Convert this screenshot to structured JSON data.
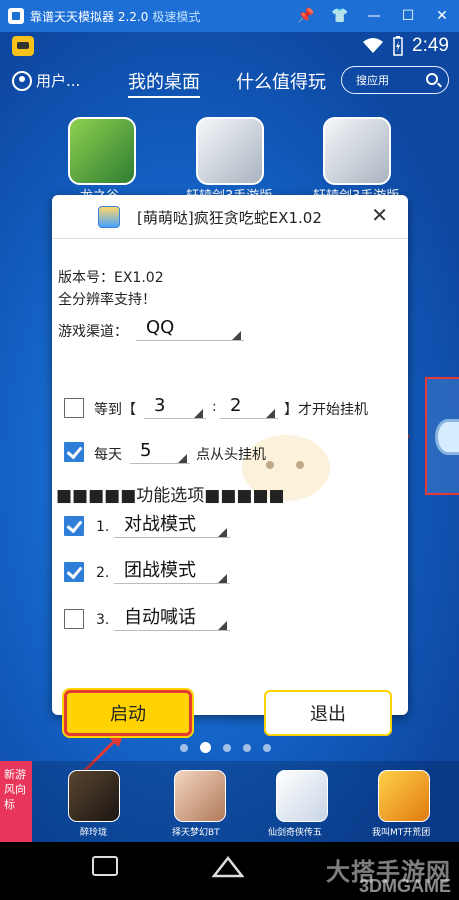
{
  "emulator": {
    "title": "靠谱天天模拟器 2.2.0",
    "mode": "极速模式",
    "controls": [
      "pin-icon",
      "skin-icon",
      "minimize-icon",
      "maximize-icon",
      "close-icon"
    ]
  },
  "status_bar": {
    "time": "2:49"
  },
  "top_nav": {
    "user_label": "用户...",
    "tabs": [
      "我的桌面",
      "什么值得玩"
    ],
    "search_placeholder": "搜应用"
  },
  "desktop_apps": [
    {
      "label": "龙之谷",
      "color": "#6bbf3a"
    },
    {
      "label": "轩辕剑3手游版",
      "color": "#e9eef4"
    },
    {
      "label": "轩辕剑3手游版",
      "color": "#e9eef4"
    }
  ],
  "dialog": {
    "title": "[萌萌哒]疯狂贪吃蛇EX1.02",
    "version_line": "版本号：EX1.02",
    "support_line": "全分辨率支持！",
    "channel_label": "游戏渠道：",
    "channel_value": "QQ",
    "wait_label": "等到【",
    "wait_hour": "3",
    "wait_sep": ":",
    "wait_min": "2",
    "wait_suffix": "】才开始挂机",
    "daily_label": "每天",
    "daily_hour": "5",
    "daily_suffix": "点从头挂机",
    "section_header": "■■■■■功能选项■■■■■",
    "options": [
      {
        "num": "1.",
        "value": "对战模式",
        "checked": true
      },
      {
        "num": "2.",
        "value": "团战模式",
        "checked": true
      },
      {
        "num": "3.",
        "value": "自动喊话",
        "checked": false
      }
    ],
    "start_label": "启动",
    "exit_label": "退出"
  },
  "pager": {
    "pages": 5,
    "active": 1
  },
  "new_tag": "新游风向标",
  "dock_apps": [
    {
      "label": "醉玲珑",
      "color": "#3a2a1a"
    },
    {
      "label": "择天梦幻BT",
      "color": "#d9b59a"
    },
    {
      "label": "仙剑奇侠传五",
      "color": "#f2f2f2"
    },
    {
      "label": "我叫MT开荒团",
      "color": "#f0a51d"
    }
  ],
  "watermark": {
    "line1": "大搭手游网",
    "line2": "3DMGAME"
  }
}
